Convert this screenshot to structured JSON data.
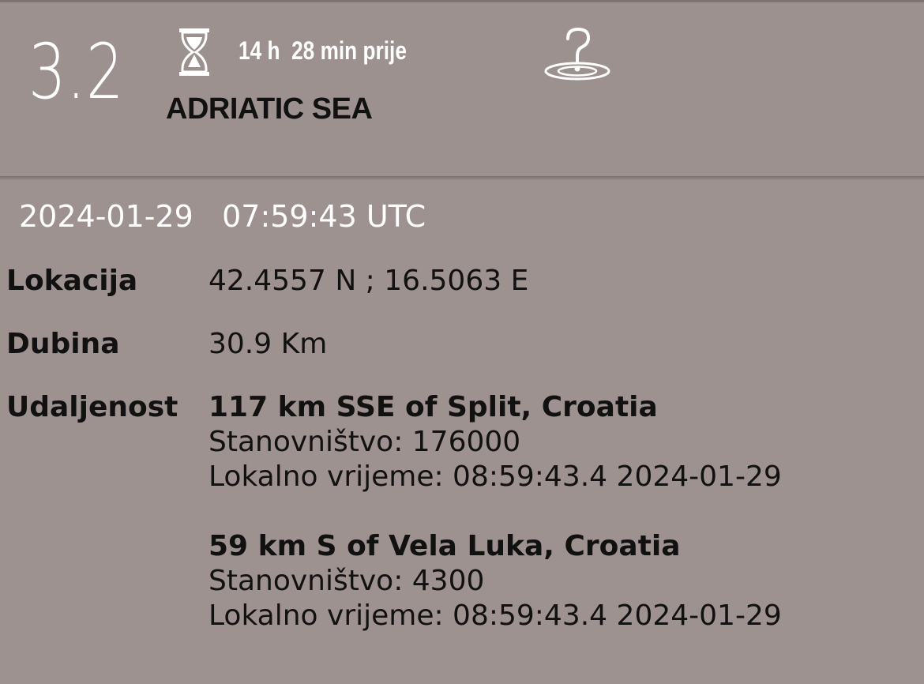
{
  "event": {
    "magnitude": "3.2",
    "time_ago": "14 h  28 min prije",
    "region": "ADRIATIC SEA",
    "date": "2024-01-29",
    "time": "07:59:43",
    "timezone": "UTC"
  },
  "icons": {
    "hourglass": "hourglass-icon",
    "help": "question-mark-icon"
  },
  "details": {
    "location_label": "Lokacija",
    "location_value": "42.4557 N ; 16.5063 E",
    "depth_label": "Dubina",
    "depth_value": "30.9 Km",
    "distance_label": "Udaljenost",
    "distances": [
      {
        "title": "117 km SSE of Split, Croatia",
        "population": "Stanovništvo: 176000",
        "local_time": "Lokalno vrijeme: 08:59:43.4 2024-01-29"
      },
      {
        "title": "59 km S of Vela Luka, Croatia",
        "population": "Stanovništvo: 4300",
        "local_time": "Lokalno vrijeme: 08:59:43.4 2024-01-29"
      }
    ]
  },
  "colors": {
    "background": "#9e9290",
    "header_text": "#ffffff",
    "body_text": "#111111"
  }
}
